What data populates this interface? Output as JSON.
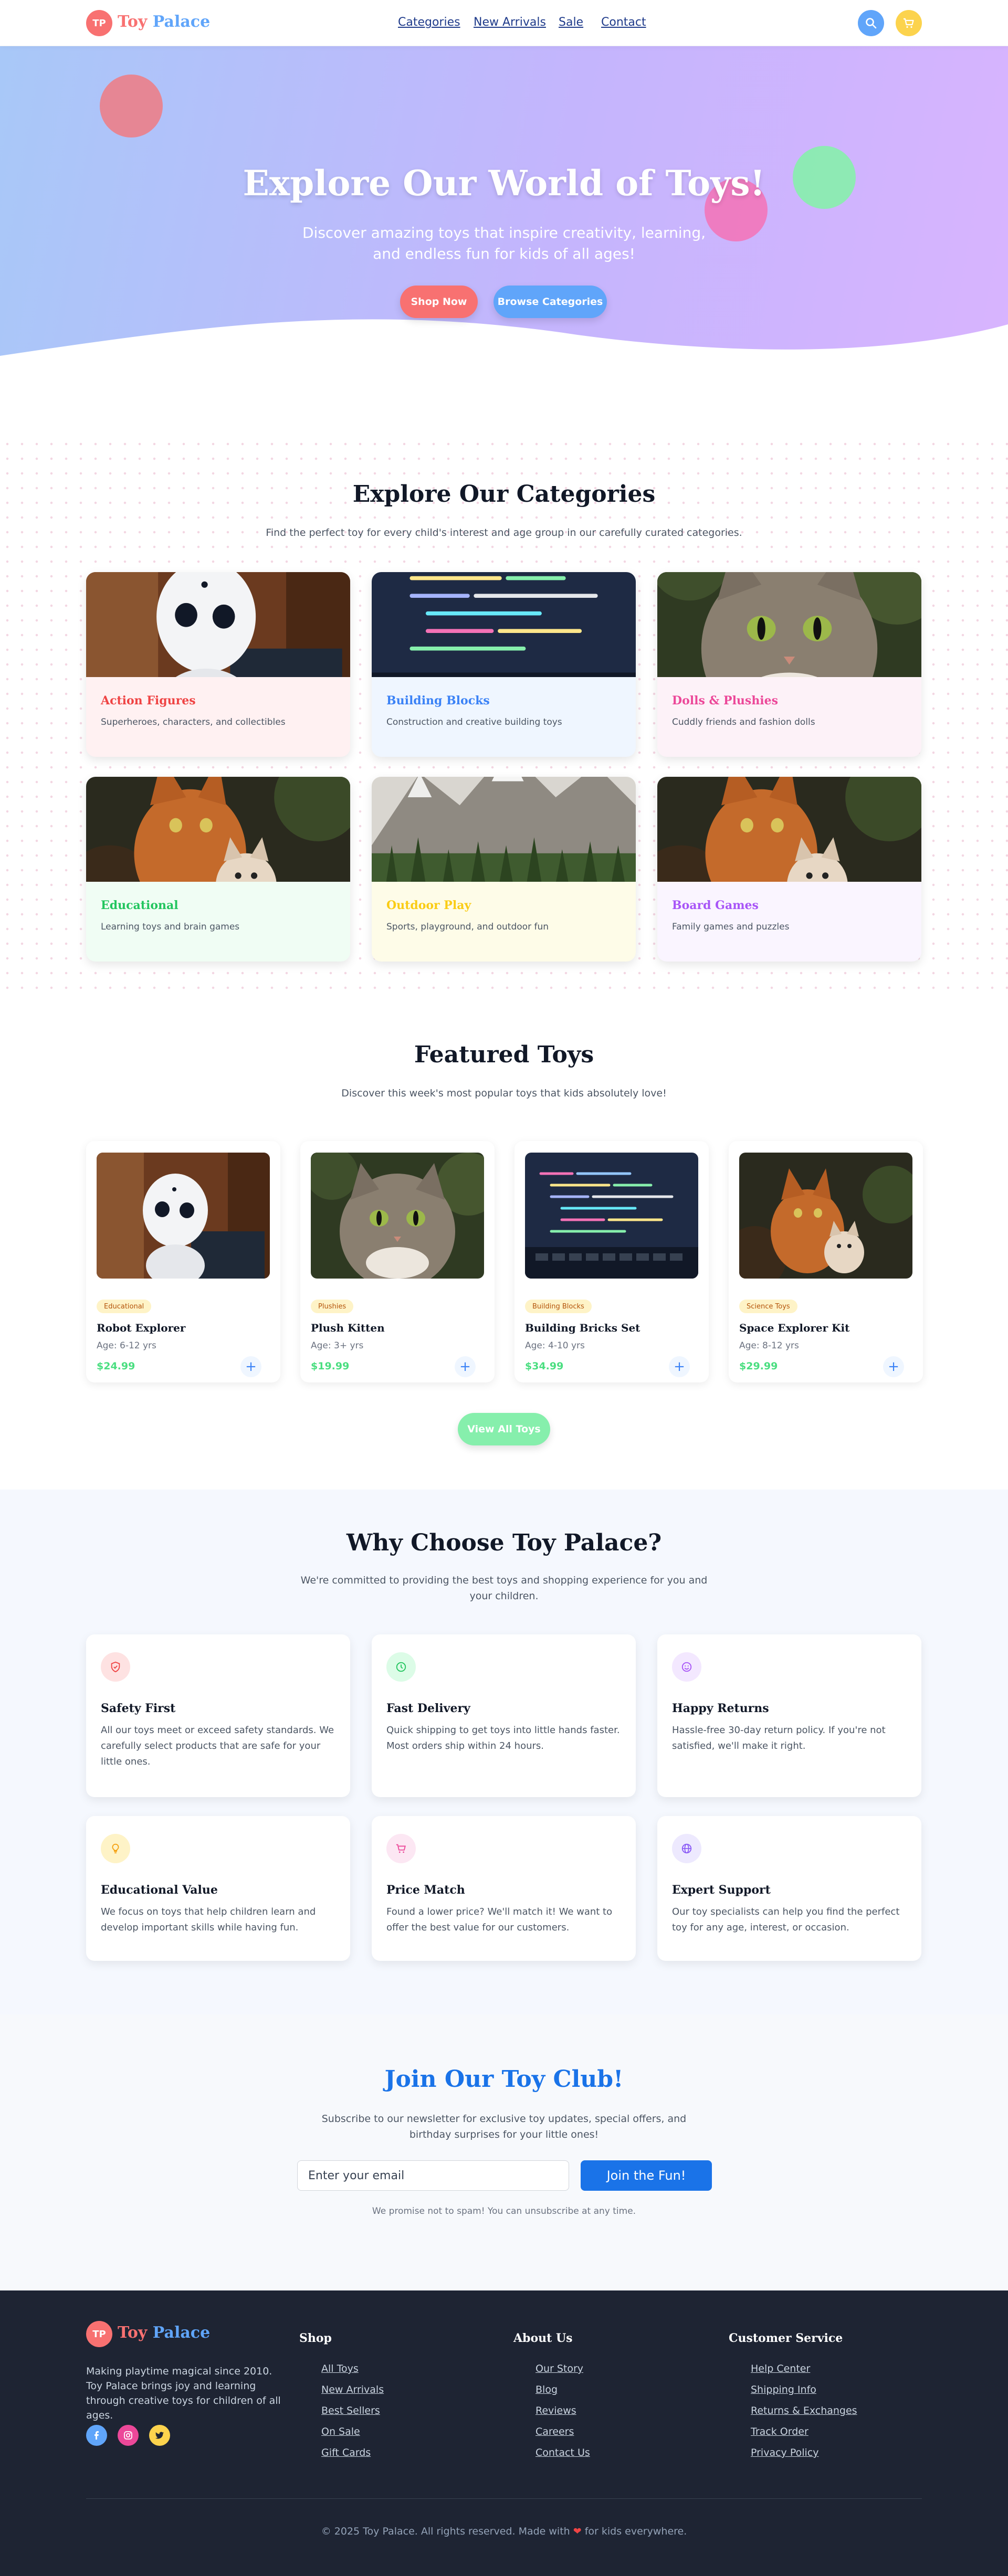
{
  "brand": {
    "badge": "TP",
    "name_part1": "Toy",
    "name_part2": "Palace"
  },
  "nav": {
    "links": [
      "Categories",
      "New Arrivals",
      "Sale",
      "Contact"
    ],
    "search_icon": "search-icon",
    "cart_icon": "cart-icon"
  },
  "hero": {
    "title": "Explore Our World of Toys!",
    "subtitle": "Discover amazing toys that inspire creativity, learning, and endless fun for kids of all ages!",
    "primary_button": "Shop Now",
    "secondary_button": "Browse Categories"
  },
  "categories": {
    "title": "Explore Our Categories",
    "subtitle": "Find the perfect toy for every child's interest and age group in our carefully curated categories.",
    "items": [
      {
        "name": "Action Figures",
        "desc": "Superheroes, characters, and collectibles",
        "color": "#ef4444",
        "bg": "#fff1f2",
        "image": "robot"
      },
      {
        "name": "Building Blocks",
        "desc": "Construction and creative building toys",
        "color": "#3b82f6",
        "bg": "#eff6ff",
        "image": "code"
      },
      {
        "name": "Dolls & Plushies",
        "desc": "Cuddly friends and fashion dolls",
        "color": "#ec4899",
        "bg": "#fdf2f8",
        "image": "cat"
      },
      {
        "name": "Educational",
        "desc": "Learning toys and brain games",
        "color": "#22c55e",
        "bg": "#f0fdf4",
        "image": "kittens"
      },
      {
        "name": "Outdoor Play",
        "desc": "Sports, playground, and outdoor fun",
        "color": "#facc15",
        "bg": "#fefce8",
        "image": "mountain"
      },
      {
        "name": "Board Games",
        "desc": "Family games and puzzles",
        "color": "#a855f7",
        "bg": "#faf5ff",
        "image": "kittens"
      }
    ]
  },
  "featured": {
    "title": "Featured Toys",
    "subtitle": "Discover this week's most popular toys that kids absolutely love!",
    "view_all": "View All Toys",
    "products": [
      {
        "tag": "Educational",
        "name": "Robot Explorer",
        "age": "Age: 6-12 yrs",
        "price": "$24.99",
        "image": "robot"
      },
      {
        "tag": "Plushies",
        "name": "Plush Kitten",
        "age": "Age: 3+ yrs",
        "price": "$19.99",
        "image": "cat"
      },
      {
        "tag": "Building Blocks",
        "name": "Building Bricks Set",
        "age": "Age: 4-10 yrs",
        "price": "$34.99",
        "image": "code"
      },
      {
        "tag": "Science Toys",
        "name": "Space Explorer Kit",
        "age": "Age: 8-12 yrs",
        "price": "$29.99",
        "image": "kittens"
      }
    ]
  },
  "why": {
    "title": "Why Choose Toy Palace?",
    "subtitle": "We're committed to providing the best toys and shopping experience for you and your children.",
    "items": [
      {
        "title": "Safety First",
        "text": "All our toys meet or exceed safety standards. We carefully select products that are safe for your little ones.",
        "icon": "shield-icon",
        "color": "#ef4444",
        "bg": "#fee2e2"
      },
      {
        "title": "Fast Delivery",
        "text": "Quick shipping to get toys into little hands faster. Most orders ship within 24 hours.",
        "icon": "clock-icon",
        "color": "#22c55e",
        "bg": "#dcfce7"
      },
      {
        "title": "Happy Returns",
        "text": "Hassle-free 30-day return policy. If you're not satisfied, we'll make it right.",
        "icon": "smile-icon",
        "color": "#a855f7",
        "bg": "#f3e8ff"
      },
      {
        "title": "Educational Value",
        "text": "We focus on toys that help children learn and develop important skills while having fun.",
        "icon": "lightbulb-icon",
        "color": "#f59e0b",
        "bg": "#fef3c7"
      },
      {
        "title": "Price Match",
        "text": "Found a lower price? We'll match it! We want to offer the best value for our customers.",
        "icon": "cart-icon",
        "color": "#ec4899",
        "bg": "#fce7f3"
      },
      {
        "title": "Expert Support",
        "text": "Our toy specialists can help you find the perfect toy for any age, interest, or occasion.",
        "icon": "globe-icon",
        "color": "#8b5cf6",
        "bg": "#ede9fe"
      }
    ]
  },
  "newsletter": {
    "title": "Join Our Toy Club!",
    "subtitle": "Subscribe to our newsletter for exclusive toy updates, special offers, and birthday surprises for your little ones!",
    "placeholder": "Enter your email",
    "button": "Join the Fun!",
    "note": "We promise not to spam! You can unsubscribe at any time."
  },
  "footer": {
    "about": "Making playtime magical since 2010. Toy Palace brings joy and learning through creative toys for children of all ages.",
    "socials": [
      "facebook-icon",
      "instagram-icon",
      "twitter-icon"
    ],
    "columns": [
      {
        "title": "Shop",
        "links": [
          "All Toys",
          "New Arrivals",
          "Best Sellers",
          "On Sale",
          "Gift Cards"
        ]
      },
      {
        "title": "About Us",
        "links": [
          "Our Story",
          "Blog",
          "Reviews",
          "Careers",
          "Contact Us"
        ]
      },
      {
        "title": "Customer Service",
        "links": [
          "Help Center",
          "Shipping Info",
          "Returns & Exchanges",
          "Track Order",
          "Privacy Policy"
        ]
      }
    ],
    "copyright_before": "© 2025 Toy Palace. All rights reserved. Made with",
    "copyright_after": "for kids everywhere."
  },
  "colors": {
    "accent_red": "#f87171",
    "accent_blue": "#60a5fa",
    "accent_green": "#4ade80",
    "footer_bg": "#1e2433",
    "primary_button": "#1a73e8"
  }
}
